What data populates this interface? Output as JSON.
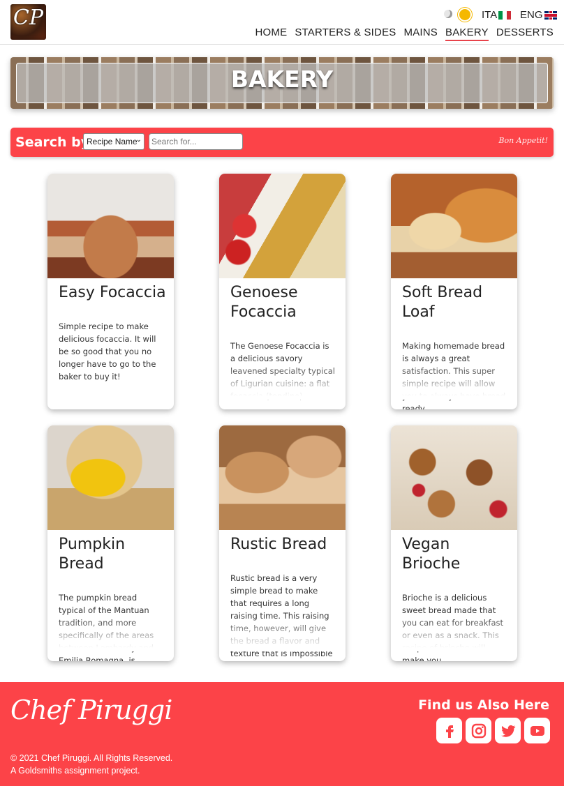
{
  "header": {
    "logo_text": "CP",
    "lang": {
      "ita": "ITA",
      "eng": "ENG"
    },
    "nav": [
      {
        "label": "HOME"
      },
      {
        "label": "STARTERS & SIDES"
      },
      {
        "label": "MAINS"
      },
      {
        "label": "BAKERY",
        "active": true
      },
      {
        "label": "DESSERTS"
      }
    ]
  },
  "banner": {
    "title": "BAKERY"
  },
  "search": {
    "label": "Search by",
    "select_value": "Recipe Name",
    "placeholder": "Search for...",
    "tagline": "Bon Appetit!"
  },
  "cards": [
    {
      "title": "Easy Focaccia",
      "desc": "Simple recipe to make delicious focaccia. It will be so good that you no longer have to go to the baker to buy it!"
    },
    {
      "title": "Genoese Focaccia",
      "desc": "The Genoese Focaccia is a delicious savory leavened specialty typical of Ligurian cuisine: a flat focaccia (tondino) ..."
    },
    {
      "title": "Soft Bread Loaf",
      "desc": "Making homemade bread is always a great satisfaction. This super simple recipe will allow you to always have bread ready..."
    },
    {
      "title": "Pumpkin Bread",
      "desc": "The pumpkin bread typical of the Mantuan tradition, and more specifically of the areas between Lombardy and Emilia Romagna, is..."
    },
    {
      "title": "Rustic Bread",
      "desc": "Rustic bread is a very simple bread to make that requires a long raising time. This raising time, however, will give the bread a flavor and texture that is impossible to..."
    },
    {
      "title": "Vegan Brioche",
      "desc": "Brioche is a delicious sweet bread made that you can eat for breakfast or even as a snack. This recipe of brioche will make you..."
    }
  ],
  "footer": {
    "signature": "Chef Piruggi",
    "find_us": "Find us Also Here",
    "copyright": "© 2021 Chef Piruggi. All Rights Reserved.",
    "project": "A Goldsmiths assignment project.",
    "socials": [
      "facebook-icon",
      "instagram-icon",
      "twitter-icon",
      "youtube-icon"
    ]
  },
  "colors": {
    "accent": "#fc4348",
    "text": "#222222"
  }
}
